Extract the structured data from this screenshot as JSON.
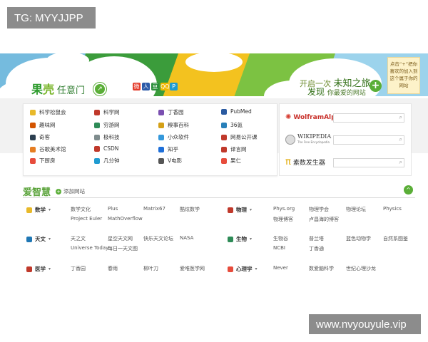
{
  "watermarks": {
    "top": "TG: MYYJJPP",
    "bottom": "www.nvyouyule.vip"
  },
  "header": {
    "logo_part1": "果",
    "logo_part2": "壳",
    "logo_sub": "任意门",
    "social": [
      "微",
      "人",
      "豆",
      "QQ",
      "P"
    ],
    "slogan_prefix": "开启一次",
    "slogan_emph": "未知之旅",
    "slogan_line2": "发现",
    "slogan_line2_small": "你最爱的网站",
    "plus": "+",
    "note": "点击“+”把你喜欢的加入到这个属于你的网站"
  },
  "sites": [
    {
      "label": "科学松鼠会",
      "color": "#e8b92a"
    },
    {
      "label": "科学网",
      "color": "#c0392b"
    },
    {
      "label": "丁香园",
      "color": "#7a4fb0"
    },
    {
      "label": "PubMed",
      "color": "#2a5aa0"
    },
    {
      "label": "趣味网",
      "color": "#d35400"
    },
    {
      "label": "穷游网",
      "color": "#2e8b57"
    },
    {
      "label": "糗事百科",
      "color": "#d4a017"
    },
    {
      "label": "36氪",
      "color": "#2980b9"
    },
    {
      "label": "奇客",
      "color": "#2c3e50"
    },
    {
      "label": "极科技",
      "color": "#7f8c8d"
    },
    {
      "label": "小众软件",
      "color": "#3498db"
    },
    {
      "label": "网易公开课",
      "color": "#c0392b"
    },
    {
      "label": "谷歌美术馆",
      "color": "#e67e22"
    },
    {
      "label": "CSDN",
      "color": "#c0392b"
    },
    {
      "label": "知乎",
      "color": "#1e6fd9"
    },
    {
      "label": "译言网",
      "color": "#c0392b"
    },
    {
      "label": "下厨房",
      "color": "#e74c3c"
    },
    {
      "label": "几分钟",
      "color": "#1f9bd1"
    },
    {
      "label": "V电影",
      "color": "#555555"
    },
    {
      "label": "果仁",
      "color": "#e74c3c"
    }
  ],
  "tools": [
    {
      "label": "WolframAlpha",
      "icon_color": "#d63b2f"
    },
    {
      "label": "WIKIPEDIA",
      "sub": "The Free Encyclopedia",
      "icon_color": "#777777"
    },
    {
      "label": "素数发生器",
      "icon_color": "#e0a800",
      "glyph": "π"
    }
  ],
  "section": {
    "title": "爱智慧",
    "add_label": "添加网站",
    "collapse": "^"
  },
  "categories": [
    {
      "name": "数学",
      "color": "#e8b92a",
      "links": [
        "数学文化",
        "Plus",
        "Matrix67",
        "酷炫数学",
        "Project Euler",
        "MathOverflow"
      ]
    },
    {
      "name": "物理",
      "color": "#c0392b",
      "links": [
        "Phys.org",
        "物理学会",
        "物理论坛",
        "Physics",
        "物理博客",
        "卢昌海的博客"
      ]
    },
    {
      "name": "天文",
      "color": "#1f77b4",
      "links": [
        "天之文",
        "星空天文网",
        "快乐天文论坛",
        "NASA",
        "Universe Today",
        "每日一天文图"
      ]
    },
    {
      "name": "生物",
      "color": "#2e8b57",
      "links": [
        "生物谷",
        "普兰塔",
        "蓝色动物学",
        "自然系图鉴",
        "NCBI",
        "丁香通"
      ]
    },
    {
      "name": "医学",
      "color": "#c0392b",
      "links": [
        "丁香园",
        "春雨",
        "柳叶刀",
        "爱唯医学网"
      ]
    },
    {
      "name": "心理学",
      "color": "#e74c3c",
      "links": [
        "Never",
        "数爱脑科学",
        "世纪心理沙龙"
      ]
    }
  ]
}
